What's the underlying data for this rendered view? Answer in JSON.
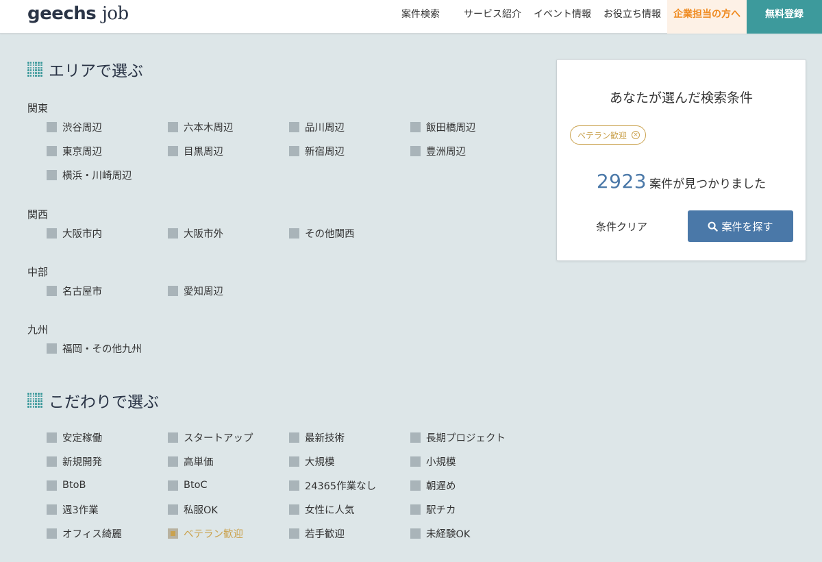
{
  "header": {
    "logo_main": "geechs",
    "logo_sub": "job",
    "nav": [
      "案件検索",
      "サービス紹介",
      "イベント情報",
      "お役立ち情報"
    ],
    "corp_link": "企業担当の方へ",
    "signup": "無料登録"
  },
  "area": {
    "title": "エリアで選ぶ",
    "regions": [
      {
        "label": "関東",
        "options": [
          "渋谷周辺",
          "六本木周辺",
          "品川周辺",
          "飯田橋周辺",
          "東京周辺",
          "目黒周辺",
          "新宿周辺",
          "豊洲周辺",
          "横浜・川崎周辺"
        ]
      },
      {
        "label": "関西",
        "options": [
          "大阪市内",
          "大阪市外",
          "その他関西"
        ]
      },
      {
        "label": "中部",
        "options": [
          "名古屋市",
          "愛知周辺"
        ]
      },
      {
        "label": "九州",
        "options": [
          "福岡・その他九州"
        ]
      }
    ]
  },
  "pref": {
    "title": "こだわりで選ぶ",
    "options": [
      "安定稼働",
      "スタートアップ",
      "最新技術",
      "長期プロジェクト",
      "新規開発",
      "高単価",
      "大規模",
      "小規模",
      "BtoB",
      "BtoC",
      "24365作業なし",
      "朝遅め",
      "週3作業",
      "私服OK",
      "女性に人気",
      "駅チカ",
      "オフィス綺麗",
      "ベテラン歓迎",
      "若手歓迎",
      "未経験OK"
    ],
    "checked": [
      "ベテラン歓迎"
    ]
  },
  "panel": {
    "title": "あなたが選んだ検索条件",
    "tag": "ベテラン歓迎",
    "count": "2923",
    "count_suffix": "案件が見つかりました",
    "clear": "条件クリア",
    "search": "案件を探す"
  },
  "colors": {
    "accent": "#3d9a9c",
    "primary": "#4a78a8",
    "selected": "#caa24e",
    "corp": "#ef8a1f",
    "background": "#dde6e8"
  }
}
